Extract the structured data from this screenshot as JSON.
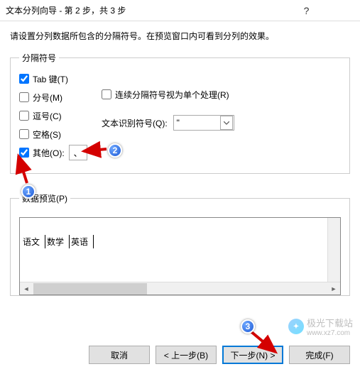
{
  "titlebar": {
    "title": "文本分列向导 - 第 2 步，共 3 步"
  },
  "instruction": "请设置分列数据所包含的分隔符号。在预览窗口内可看到分列的效果。",
  "delimiters": {
    "legend": "分隔符号",
    "tab": "Tab 键(T)",
    "semicolon": "分号(M)",
    "comma": "逗号(C)",
    "space": "空格(S)",
    "other": "其他(O):",
    "other_value": "、",
    "consecutive": "连续分隔符号视为单个处理(R)",
    "text_qualifier_label": "文本识别符号(Q):",
    "text_qualifier_value": "\""
  },
  "preview": {
    "legend": "数据预览(P)",
    "cols": [
      "语文",
      "数学",
      "英语"
    ]
  },
  "buttons": {
    "cancel": "取消",
    "back": "< 上一步(B)",
    "next": "下一步(N) >",
    "finish": "完成(F)"
  },
  "annotations": {
    "a1": "1",
    "a2": "2",
    "a3": "3"
  },
  "watermark": {
    "text": "极光下载站",
    "url": "www.xz7.com"
  }
}
